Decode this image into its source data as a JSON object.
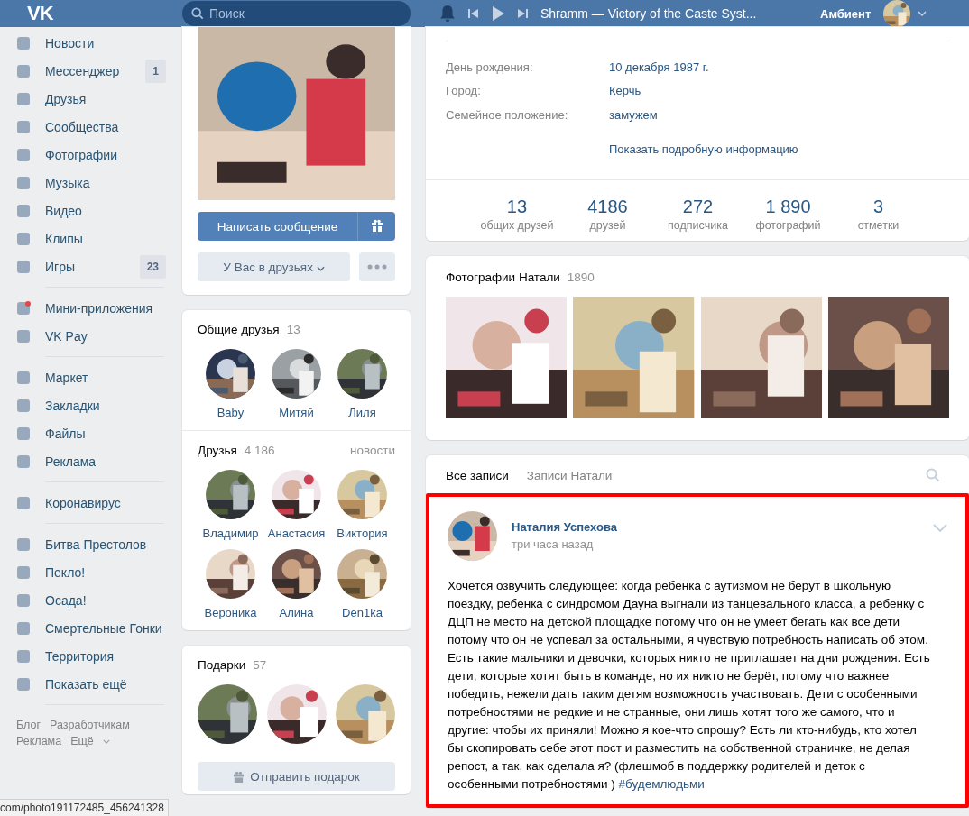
{
  "topbar": {
    "logo": "VK",
    "search": {
      "placeholder": "Поиск"
    },
    "track": "Shramm — Victory of the Caste Syst...",
    "user": "Амбиент"
  },
  "sidebar": {
    "groups": [
      [
        {
          "label": "Новости",
          "notification": false
        },
        {
          "label": "Мессенджер",
          "badge": "1",
          "notification": false
        },
        {
          "label": "Друзья",
          "notification": false
        },
        {
          "label": "Сообщества",
          "notification": false
        },
        {
          "label": "Фотографии",
          "notification": false
        },
        {
          "label": "Музыка",
          "notification": false
        },
        {
          "label": "Видео",
          "notification": false
        },
        {
          "label": "Клипы",
          "notification": false
        },
        {
          "label": "Игры",
          "badge": "23",
          "notification": false
        }
      ],
      [
        {
          "label": "Мини-приложения",
          "notification": true
        },
        {
          "label": "VK Pay",
          "notification": false
        }
      ],
      [
        {
          "label": "Маркет",
          "notification": false
        },
        {
          "label": "Закладки",
          "notification": false
        },
        {
          "label": "Файлы",
          "notification": false
        },
        {
          "label": "Реклама",
          "notification": false
        }
      ],
      [
        {
          "label": "Коронавирус",
          "notification": false
        }
      ],
      [
        {
          "label": "Битва Престолов",
          "notification": false
        },
        {
          "label": "Пекло!",
          "notification": false
        },
        {
          "label": "Осада!",
          "notification": false
        },
        {
          "label": "Смертельные Гонки",
          "notification": false
        },
        {
          "label": "Территория",
          "notification": false
        },
        {
          "label": "Показать ещё",
          "notification": false
        }
      ]
    ],
    "footer_links": [
      "Блог",
      "Разработчикам",
      "Реклама",
      "Ещё"
    ]
  },
  "profile_actions": {
    "message_button": "Написать сообщение",
    "friend_button": "У Вас в друзьях"
  },
  "common_friends": {
    "title": "Общие друзья",
    "count": "13",
    "items": [
      {
        "name": "Baby"
      },
      {
        "name": "Митяй"
      },
      {
        "name": "Лиля"
      }
    ]
  },
  "friends": {
    "title": "Друзья",
    "count": "4 186",
    "link": "новости",
    "items": [
      {
        "name": "Владимир"
      },
      {
        "name": "Анастасия"
      },
      {
        "name": "Виктория"
      },
      {
        "name": "Вероника"
      },
      {
        "name": "Алина"
      },
      {
        "name": "Den1ka"
      }
    ]
  },
  "gifts": {
    "title": "Подарки",
    "count": "57",
    "button": "Отправить подарок"
  },
  "info": {
    "rows": [
      {
        "label": "День рождения:",
        "value": "10 декабря 1987 г."
      },
      {
        "label": "Город:",
        "value": "Керчь"
      },
      {
        "label": "Семейное положение:",
        "value": "замужем"
      }
    ],
    "more_link": "Показать подробную информацию",
    "stats": [
      {
        "value": "13",
        "label": "общих друзей"
      },
      {
        "value": "4186",
        "label": "друзей"
      },
      {
        "value": "272",
        "label": "подписчика"
      },
      {
        "value": "1 890",
        "label": "фотографий"
      },
      {
        "value": "3",
        "label": "отметки"
      }
    ]
  },
  "photos": {
    "title": "Фотографии Натали",
    "count": "1890"
  },
  "wall": {
    "tabs": [
      {
        "label": "Все записи",
        "selected": true
      },
      {
        "label": "Записи Натали",
        "selected": false
      }
    ],
    "post": {
      "highlighted": true,
      "author": "Наталия Успехова",
      "time": "три часа назад",
      "text": "Хочется озвучить следующее: когда ребенка с аутизмом не берут в школьную поездку, ребенка с синдромом Дауна выгнали из танцевального класса, а ребенку с ДЦП не место на детской площадке потому что он не умеет бегать как все дети потому что он не успевал за остальными, я чувствую потребность написать об этом. Есть такие мальчики и девочки, которых никто не приглашает на дни рождения. Есть дети, которые хотят быть в команде, но их никто не берёт, потому что важнее победить, нежели дать таким детям возможность участвовать. Дети с особенными потребностями не редкие и не странные, они лишь хотят того же самого, что и другие: чтобы их приняли! Можно я кое-что спрошу? Есть ли кто-нибудь, кто хотел бы скопировать себе этот пост и разместить на собственной страничке, не делая репост, а так, как сделала я? (флешмоб в поддержку родителей и деток с особенными потребностями )",
      "hashtag": "#будемлюдьми"
    }
  },
  "status_url": "com/photo191172485_456241328"
}
